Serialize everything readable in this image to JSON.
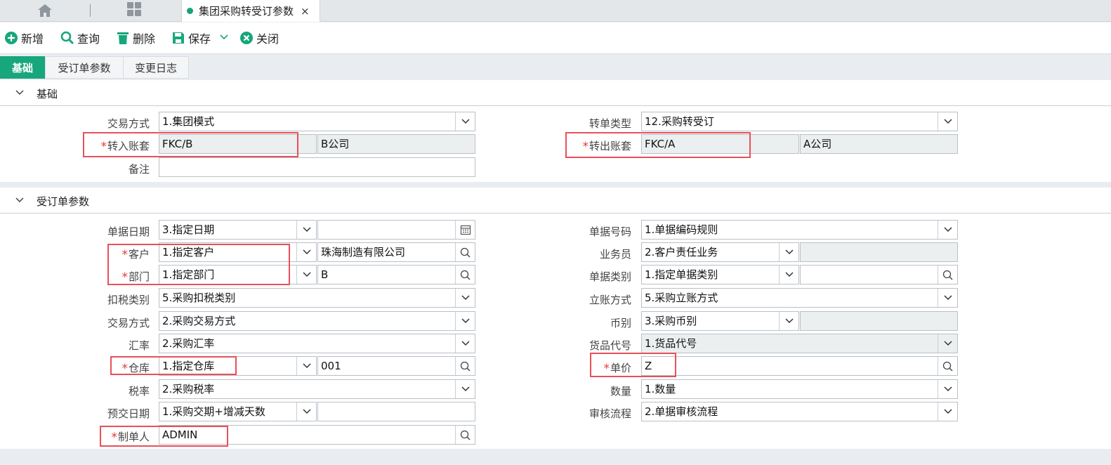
{
  "tab": {
    "title": "集团采购转受订参数",
    "close": "×"
  },
  "toolbar": {
    "add": "新增",
    "query": "查询",
    "delete": "删除",
    "save": "保存",
    "close": "关闭"
  },
  "subtabs": [
    "基础",
    "受订单参数",
    "变更日志"
  ],
  "basic": {
    "title": "基础",
    "labels": {
      "trade_mode": "交易方式",
      "in_account": "转入账套",
      "remark": "备注",
      "convert_type": "转单类型",
      "out_account": "转出账套"
    },
    "values": {
      "trade_mode": "1.集团模式",
      "in_account": "FKC/B",
      "in_company": "B公司",
      "remark": "",
      "convert_type": "12.采购转受订",
      "out_account": "FKC/A",
      "out_company": "A公司"
    }
  },
  "order": {
    "title": "受订单参数",
    "labels": {
      "doc_date": "单据日期",
      "customer": "客户",
      "dept": "部门",
      "tax_cat": "扣税类别",
      "trade_mode": "交易方式",
      "rate": "汇率",
      "warehouse": "仓库",
      "tax_rate": "税率",
      "deliv_date": "预交日期",
      "maker": "制单人",
      "doc_no": "单据号码",
      "salesman": "业务员",
      "doc_cat": "单据类别",
      "acct_mode": "立账方式",
      "currency": "币别",
      "goods_code": "货品代号",
      "price": "单价",
      "qty": "数量",
      "audit": "审核流程"
    },
    "values": {
      "doc_date": "3.指定日期",
      "doc_date_val": "",
      "customer": "1.指定客户",
      "customer_val": "珠海制造有限公司",
      "dept": "1.指定部门",
      "dept_val": "B",
      "tax_cat": "5.采购扣税类别",
      "trade_mode": "2.采购交易方式",
      "rate": "2.采购汇率",
      "warehouse": "1.指定仓库",
      "warehouse_val": "001",
      "tax_rate": "2.采购税率",
      "deliv_date": "1.采购交期+增减天数",
      "deliv_date_val": "",
      "maker": "ADMIN",
      "doc_no": "1.单据编码规则",
      "salesman": "2.客户责任业务",
      "salesman_val": "",
      "doc_cat": "1.指定单据类别",
      "doc_cat_val": "",
      "acct_mode": "5.采购立账方式",
      "currency": "3.采购币别",
      "currency_val": "",
      "goods_code": "1.货品代号",
      "price": "Z",
      "qty": "1.数量",
      "audit": "2.单据审核流程"
    }
  },
  "required_mark": "*",
  "colors": {
    "accent": "#18a67c",
    "highlight": "#e8505a",
    "required": "#e53935"
  }
}
